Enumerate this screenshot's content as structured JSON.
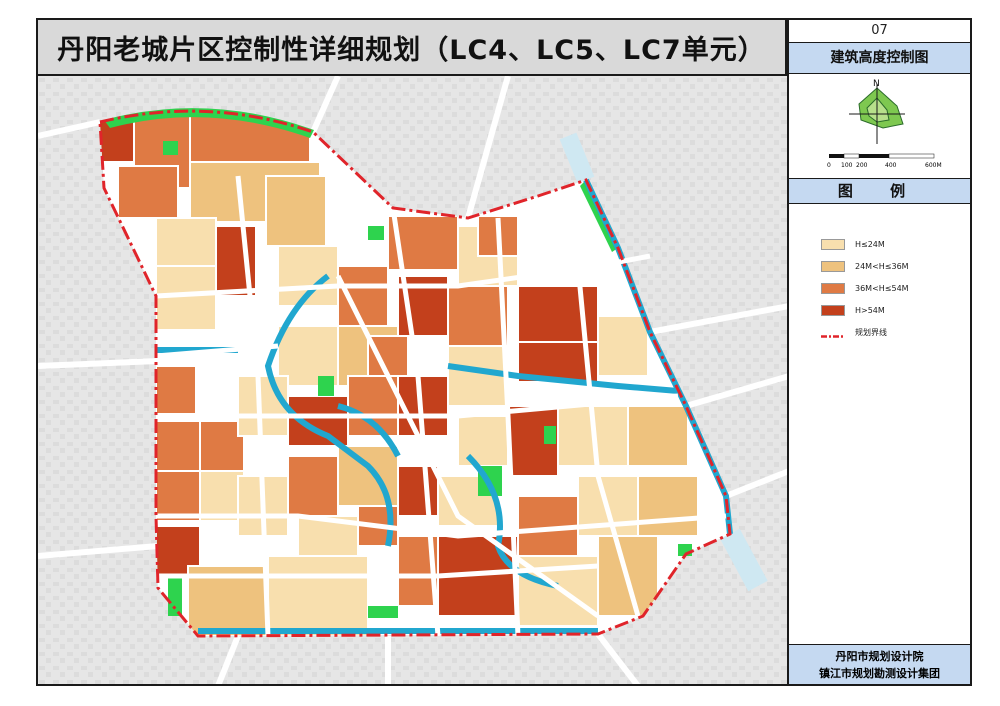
{
  "title": "丹阳老城片区控制性详细规划（LC4、LC5、LC7单元）",
  "sheet_number": "07",
  "sheet_title": "建筑高度控制图",
  "legend_heading": "图  例",
  "compass": {
    "north_label": "N",
    "scale_labels": [
      "0",
      "100",
      "200",
      "400",
      "600M"
    ]
  },
  "legend_items": [
    {
      "label": "H≤24M",
      "color": "#f8dfae"
    },
    {
      "label": "24M<H≤36M",
      "color": "#eec27e"
    },
    {
      "label": "36M<H≤54M",
      "color": "#df7a44"
    },
    {
      "label": "H>54M",
      "color": "#c3401c"
    },
    {
      "label": "规划界线",
      "color": "#e0242a"
    }
  ],
  "footer": {
    "line1": "丹阳市规划设计院",
    "line2": "镇江市规划勘测设计集团"
  },
  "colors": {
    "low": "#f8dfae",
    "mid": "#eec27e",
    "midhigh": "#df7a44",
    "high": "#c3401c",
    "green": "#2ed34e",
    "water": "#21a7cf",
    "road": "#ffffff",
    "boundary": "#e0242a",
    "background": "#e9e9e9"
  }
}
